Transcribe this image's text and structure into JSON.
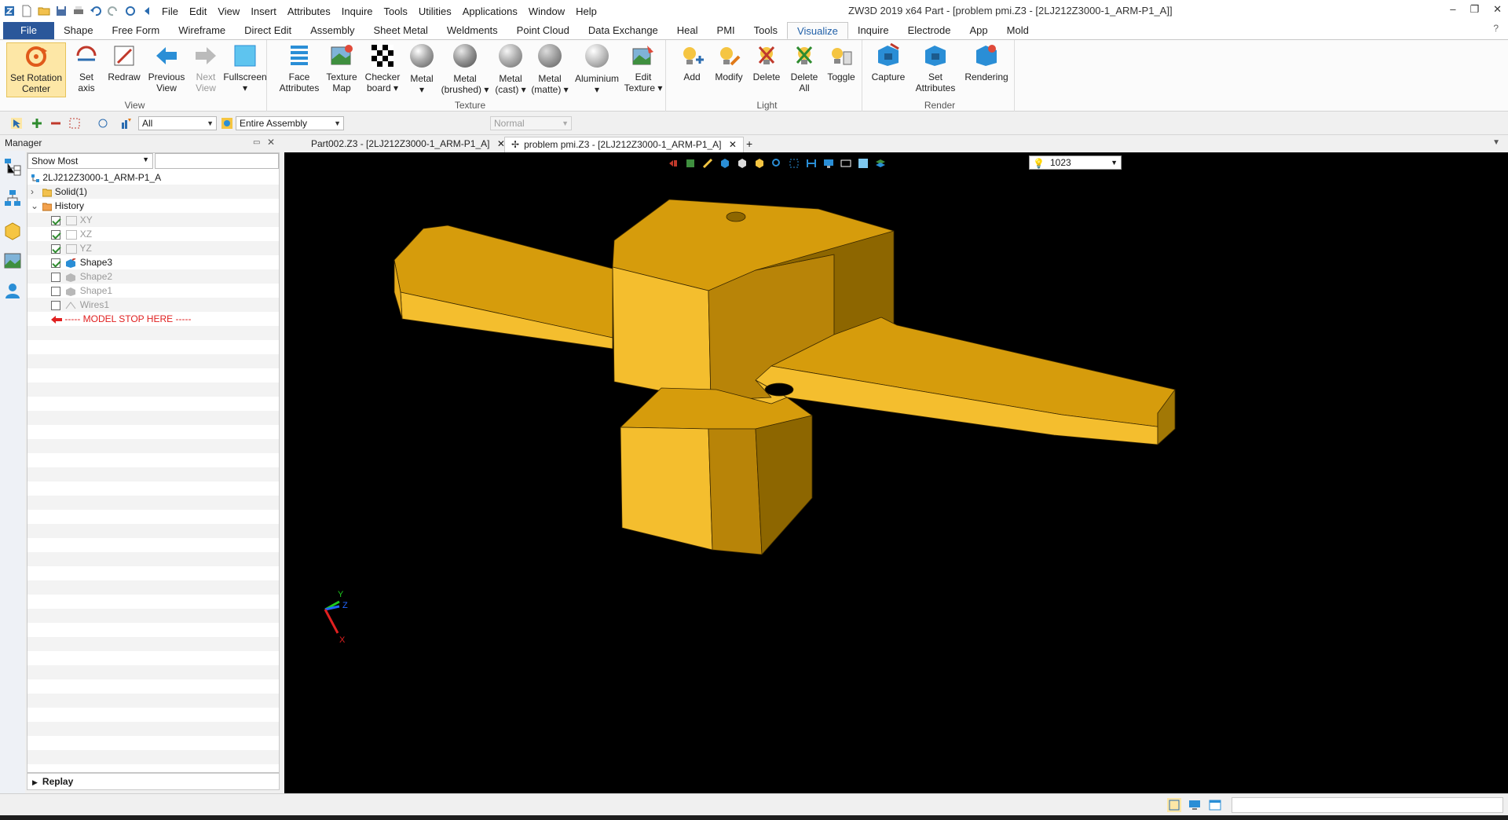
{
  "window": {
    "title": "ZW3D 2019  x64        Part - [problem pmi.Z3 - [2LJ212Z3000-1_ARM-P1_A]]"
  },
  "menubar": [
    "File",
    "Edit",
    "View",
    "Insert",
    "Attributes",
    "Inquire",
    "Tools",
    "Utilities",
    "Applications",
    "Window",
    "Help"
  ],
  "ribbon_tabs": [
    "File",
    "Shape",
    "Free Form",
    "Wireframe",
    "Direct Edit",
    "Assembly",
    "Sheet Metal",
    "Weldments",
    "Point Cloud",
    "Data Exchange",
    "Heal",
    "PMI",
    "Tools",
    "Visualize",
    "Inquire",
    "Electrode",
    "App",
    "Mold"
  ],
  "active_tab": "Visualize",
  "ribbon": {
    "view": {
      "label": "View",
      "buttons": [
        {
          "line1": "Set Rotation",
          "line2": "Center",
          "icon": "rotation-center-icon"
        },
        {
          "line1": "Set",
          "line2": "axis",
          "icon": "set-axis-icon"
        },
        {
          "line1": "Redraw",
          "line2": "",
          "icon": "redraw-icon"
        },
        {
          "line1": "Previous",
          "line2": "View",
          "icon": "previous-view-icon"
        },
        {
          "line1": "Next",
          "line2": "View",
          "icon": "next-view-icon"
        },
        {
          "line1": "Fullscreen",
          "line2": "▾",
          "icon": "fullscreen-icon"
        }
      ]
    },
    "texture": {
      "label": "Texture",
      "buttons": [
        {
          "line1": "Face",
          "line2": "Attributes",
          "icon": "face-attributes-icon"
        },
        {
          "line1": "Texture",
          "line2": "Map",
          "icon": "texture-map-icon"
        },
        {
          "line1": "Checker",
          "line2": "board ▾",
          "icon": "checkerboard-icon"
        },
        {
          "line1": "Metal",
          "line2": "▾",
          "icon": "metal-sphere-icon"
        },
        {
          "line1": "Metal",
          "line2": "(brushed) ▾",
          "icon": "metal-brushed-sphere-icon"
        },
        {
          "line1": "Metal",
          "line2": "(cast) ▾",
          "icon": "metal-cast-sphere-icon"
        },
        {
          "line1": "Metal",
          "line2": "(matte) ▾",
          "icon": "metal-matte-sphere-icon"
        },
        {
          "line1": "Aluminium",
          "line2": "▾",
          "icon": "aluminium-sphere-icon"
        },
        {
          "line1": "Edit",
          "line2": "Texture ▾",
          "icon": "edit-texture-icon"
        }
      ]
    },
    "light": {
      "label": "Light",
      "buttons": [
        {
          "line1": "Add",
          "line2": "",
          "icon": "add-light-icon"
        },
        {
          "line1": "Modify",
          "line2": "",
          "icon": "modify-light-icon"
        },
        {
          "line1": "Delete",
          "line2": "",
          "icon": "delete-light-icon"
        },
        {
          "line1": "Delete",
          "line2": "All",
          "icon": "delete-all-lights-icon"
        },
        {
          "line1": "Toggle",
          "line2": "",
          "icon": "toggle-light-icon"
        }
      ]
    },
    "render": {
      "label": "Render",
      "buttons": [
        {
          "line1": "Capture",
          "line2": "",
          "icon": "capture-icon"
        },
        {
          "line1": "Set",
          "line2": "Attributes",
          "icon": "set-attributes-icon"
        },
        {
          "line1": "Rendering",
          "line2": "",
          "icon": "rendering-icon"
        }
      ]
    }
  },
  "toolbar": {
    "filter_value": "All",
    "scope_value": "Entire Assembly",
    "mode_value": "Normal"
  },
  "manager": {
    "title": "Manager",
    "show_value": "Show Most",
    "root": "2LJ212Z3000-1_ARM-P1_A",
    "solid": "Solid(1)",
    "history": "History",
    "items": [
      {
        "label": "XY",
        "checked": true,
        "dim": true
      },
      {
        "label": "XZ",
        "checked": true,
        "dim": true
      },
      {
        "label": "YZ",
        "checked": true,
        "dim": true
      },
      {
        "label": "Shape3",
        "checked": true,
        "dim": false
      },
      {
        "label": "Shape2",
        "checked": false,
        "dim": true
      },
      {
        "label": "Shape1",
        "checked": false,
        "dim": true
      },
      {
        "label": "Wires1",
        "checked": false,
        "dim": true
      }
    ],
    "stop_marker": "----- MODEL STOP HERE -----",
    "replay": "Replay"
  },
  "doc_tabs": [
    {
      "label": "Part002.Z3 - [2LJ212Z3000-1_ARM-P1_A]",
      "active": false
    },
    {
      "label": "problem pmi.Z3 - [2LJ212Z3000-1_ARM-P1_A]",
      "active": true
    }
  ],
  "viewport": {
    "light_value": "1023",
    "axis_labels": {
      "x": "X",
      "y": "Y",
      "z": "Z"
    }
  },
  "colors": {
    "accent": "#2b579a",
    "model_face_light": "#f4be2e",
    "model_face_mid": "#d69c0c",
    "model_face_dark": "#8d6600"
  }
}
